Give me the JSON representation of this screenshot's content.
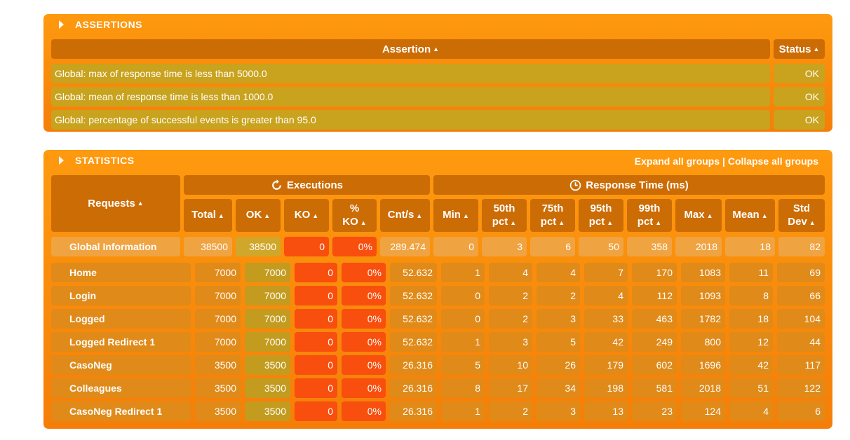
{
  "assertions": {
    "title": "ASSERTIONS",
    "col_assertion": "Assertion",
    "col_status": "Status",
    "rows": [
      {
        "text": "Global: max of response time is less than 5000.0",
        "status": "OK"
      },
      {
        "text": "Global: mean of response time is less than 1000.0",
        "status": "OK"
      },
      {
        "text": "Global: percentage of successful events is greater than 95.0",
        "status": "OK"
      }
    ]
  },
  "statistics": {
    "title": "STATISTICS",
    "expand_all": "Expand all groups",
    "separator": "|",
    "collapse_all": "Collapse all groups",
    "group_executions": "Executions",
    "group_response": "Response Time (ms)",
    "col_requests": "Requests",
    "columns": [
      "Total",
      "OK",
      "KO",
      "% KO",
      "Cnt/s",
      "Min",
      "50th pct",
      "75th pct",
      "95th pct",
      "99th pct",
      "Max",
      "Mean",
      "Std Dev"
    ],
    "global": {
      "name": "Global Information",
      "values": [
        "38500",
        "38500",
        "0",
        "0%",
        "289.474",
        "0",
        "3",
        "6",
        "50",
        "358",
        "2018",
        "18",
        "82"
      ]
    },
    "rows": [
      {
        "name": "Home",
        "values": [
          "7000",
          "7000",
          "0",
          "0%",
          "52.632",
          "1",
          "4",
          "4",
          "7",
          "170",
          "1083",
          "11",
          "69"
        ]
      },
      {
        "name": "Login",
        "values": [
          "7000",
          "7000",
          "0",
          "0%",
          "52.632",
          "0",
          "2",
          "2",
          "4",
          "112",
          "1093",
          "8",
          "66"
        ]
      },
      {
        "name": "Logged",
        "values": [
          "7000",
          "7000",
          "0",
          "0%",
          "52.632",
          "0",
          "2",
          "3",
          "33",
          "463",
          "1782",
          "18",
          "104"
        ]
      },
      {
        "name": "Logged Redirect 1",
        "values": [
          "7000",
          "7000",
          "0",
          "0%",
          "52.632",
          "1",
          "3",
          "5",
          "42",
          "249",
          "800",
          "12",
          "44"
        ]
      },
      {
        "name": "CasoNeg",
        "values": [
          "3500",
          "3500",
          "0",
          "0%",
          "26.316",
          "5",
          "10",
          "26",
          "179",
          "602",
          "1696",
          "42",
          "117"
        ]
      },
      {
        "name": "Colleagues",
        "values": [
          "3500",
          "3500",
          "0",
          "0%",
          "26.316",
          "8",
          "17",
          "34",
          "198",
          "581",
          "2018",
          "51",
          "122"
        ]
      },
      {
        "name": "CasoNeg Redirect 1",
        "values": [
          "3500",
          "3500",
          "0",
          "0%",
          "26.316",
          "1",
          "2",
          "3",
          "13",
          "23",
          "124",
          "4",
          "6"
        ]
      }
    ]
  },
  "colors": {
    "panel": "#fe9a0f",
    "header": "#cc6c05",
    "assert_row": "#c9a21e",
    "ko": "#f84e0e",
    "ok": "#c39b1e"
  }
}
